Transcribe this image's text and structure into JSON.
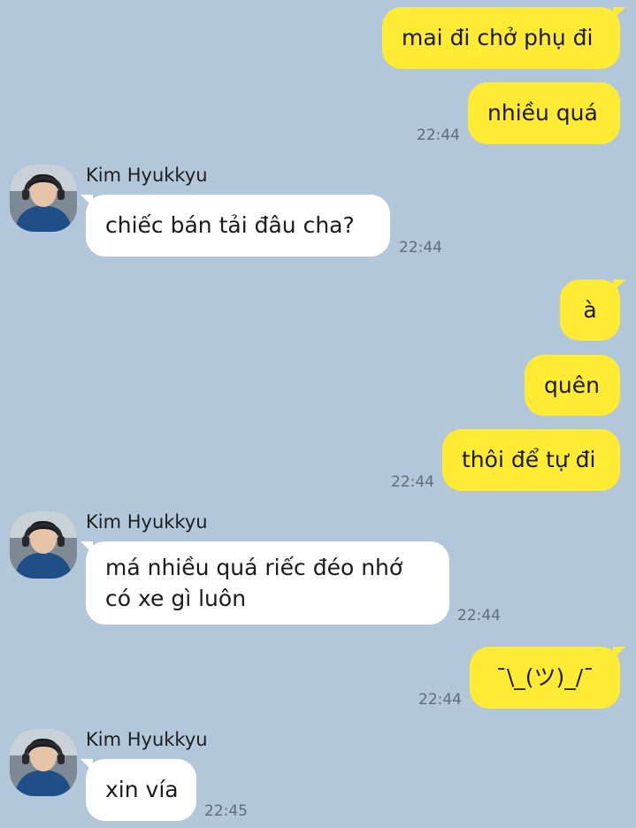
{
  "contact": {
    "name": "Kim Hyukkyu"
  },
  "messages": [
    {
      "id": "m1",
      "sender": "me",
      "text": "mai đi chở phụ đi"
    },
    {
      "id": "m2",
      "sender": "me",
      "text": "nhiều quá",
      "time": "22:44"
    },
    {
      "id": "m3",
      "sender": "them",
      "text": "chiếc bán tải đâu cha?",
      "time": "22:44"
    },
    {
      "id": "m4",
      "sender": "me",
      "text": "à"
    },
    {
      "id": "m5",
      "sender": "me",
      "text": "quên"
    },
    {
      "id": "m6",
      "sender": "me",
      "text": "thôi để tự đi",
      "time": "22:44"
    },
    {
      "id": "m7",
      "sender": "them",
      "lines": [
        "má nhiều quá riếc đéo nhớ",
        "có xe gì luôn"
      ],
      "time": "22:44"
    },
    {
      "id": "m8",
      "sender": "me",
      "text": "¯\\_(ツ)_/¯",
      "time": "22:44"
    },
    {
      "id": "m9",
      "sender": "them",
      "text": "xin vía",
      "time": "22:45"
    }
  ],
  "colors": {
    "background": "#b2c7da",
    "my_bubble": "#ffeb33",
    "their_bubble": "#ffffff",
    "timestamp": "#5e6d7a"
  }
}
